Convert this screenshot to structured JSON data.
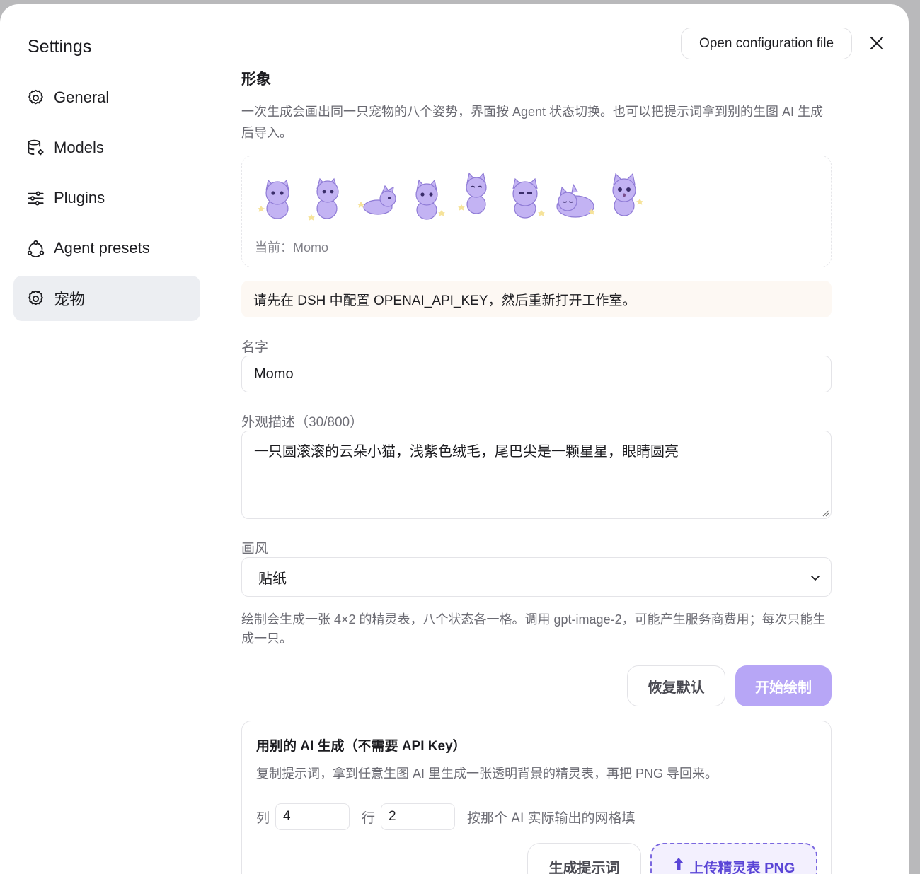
{
  "sidebar": {
    "title": "Settings",
    "items": [
      {
        "label": "General",
        "icon": "gear-icon"
      },
      {
        "label": "Models",
        "icon": "database-icon"
      },
      {
        "label": "Plugins",
        "icon": "sliders-icon"
      },
      {
        "label": "Agent presets",
        "icon": "presets-icon"
      },
      {
        "label": "宠物",
        "icon": "gear-icon",
        "active": true
      }
    ]
  },
  "header": {
    "open_config_label": "Open configuration file",
    "close_icon": "close-icon"
  },
  "pet": {
    "section_title": "形象",
    "description": "一次生成会画出同一只宠物的八个姿势，界面按 Agent 状态切换。也可以把提示词拿到别的生图 AI 生成后导入。",
    "current_label": "当前：",
    "current_value": "Momo",
    "warning": "请先在 DSH 中配置 OPENAI_API_KEY，然后重新打开工作室。",
    "name_label": "名字",
    "name_value": "Momo",
    "appearance_label": "外观描述（30/800）",
    "appearance_value": "一只圆滚滚的云朵小猫，浅紫色绒毛，尾巴尖是一颗星星，眼睛圆亮",
    "style_label": "画风",
    "style_value": "贴纸",
    "hint": "绘制会生成一张 4×2 的精灵表，八个状态各一格。调用 gpt-image-2，可能产生服务商费用；每次只能生成一只。",
    "reset_label": "恢复默认",
    "draw_label": "开始绘制"
  },
  "alt": {
    "title": "用别的 AI 生成（不需要 API Key）",
    "description": "复制提示词，拿到任意生图 AI 里生成一张透明背景的精灵表，再把 PNG 导回来。",
    "cols_label": "列",
    "cols_value": "4",
    "rows_label": "行",
    "rows_value": "2",
    "grid_hint": "按那个 AI 实际输出的网格填",
    "prompt_button": "生成提示词",
    "upload_button": "上传精灵表 PNG"
  },
  "colors": {
    "accent": "#b7a6f6",
    "upload_accent": "#5a45d6",
    "pet_fur": "#b8a6ef",
    "warning_bg": "#fdf8f3"
  }
}
